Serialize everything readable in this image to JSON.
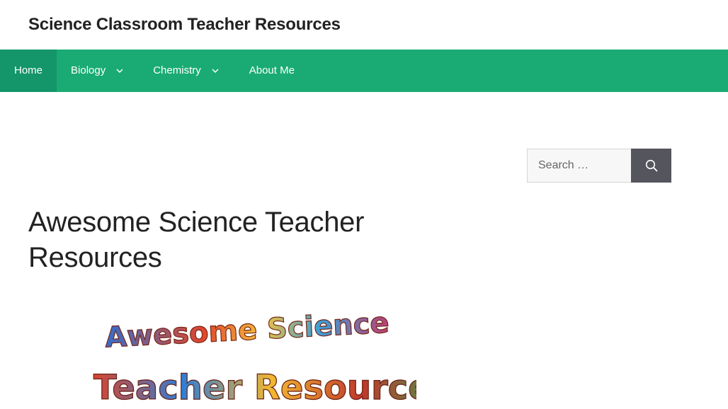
{
  "site": {
    "title": "Science Classroom Teacher Resources"
  },
  "nav": {
    "items": [
      {
        "label": "Home",
        "active": true,
        "has_dropdown": false
      },
      {
        "label": "Biology",
        "active": false,
        "has_dropdown": true
      },
      {
        "label": "Chemistry",
        "active": false,
        "has_dropdown": true
      },
      {
        "label": "About Me",
        "active": false,
        "has_dropdown": false
      }
    ],
    "dropdown_icon": "chevron-down-icon"
  },
  "search": {
    "placeholder": "Search …",
    "value": "",
    "button_icon": "search-icon"
  },
  "main": {
    "page_title": "Awesome Science Teacher Resources",
    "hero_image": {
      "line1": "Awesome Science",
      "line2": "Teacher Resources"
    }
  },
  "colors": {
    "nav_background": "#1aab74",
    "nav_active": "#14956a",
    "search_button": "#55555e"
  }
}
